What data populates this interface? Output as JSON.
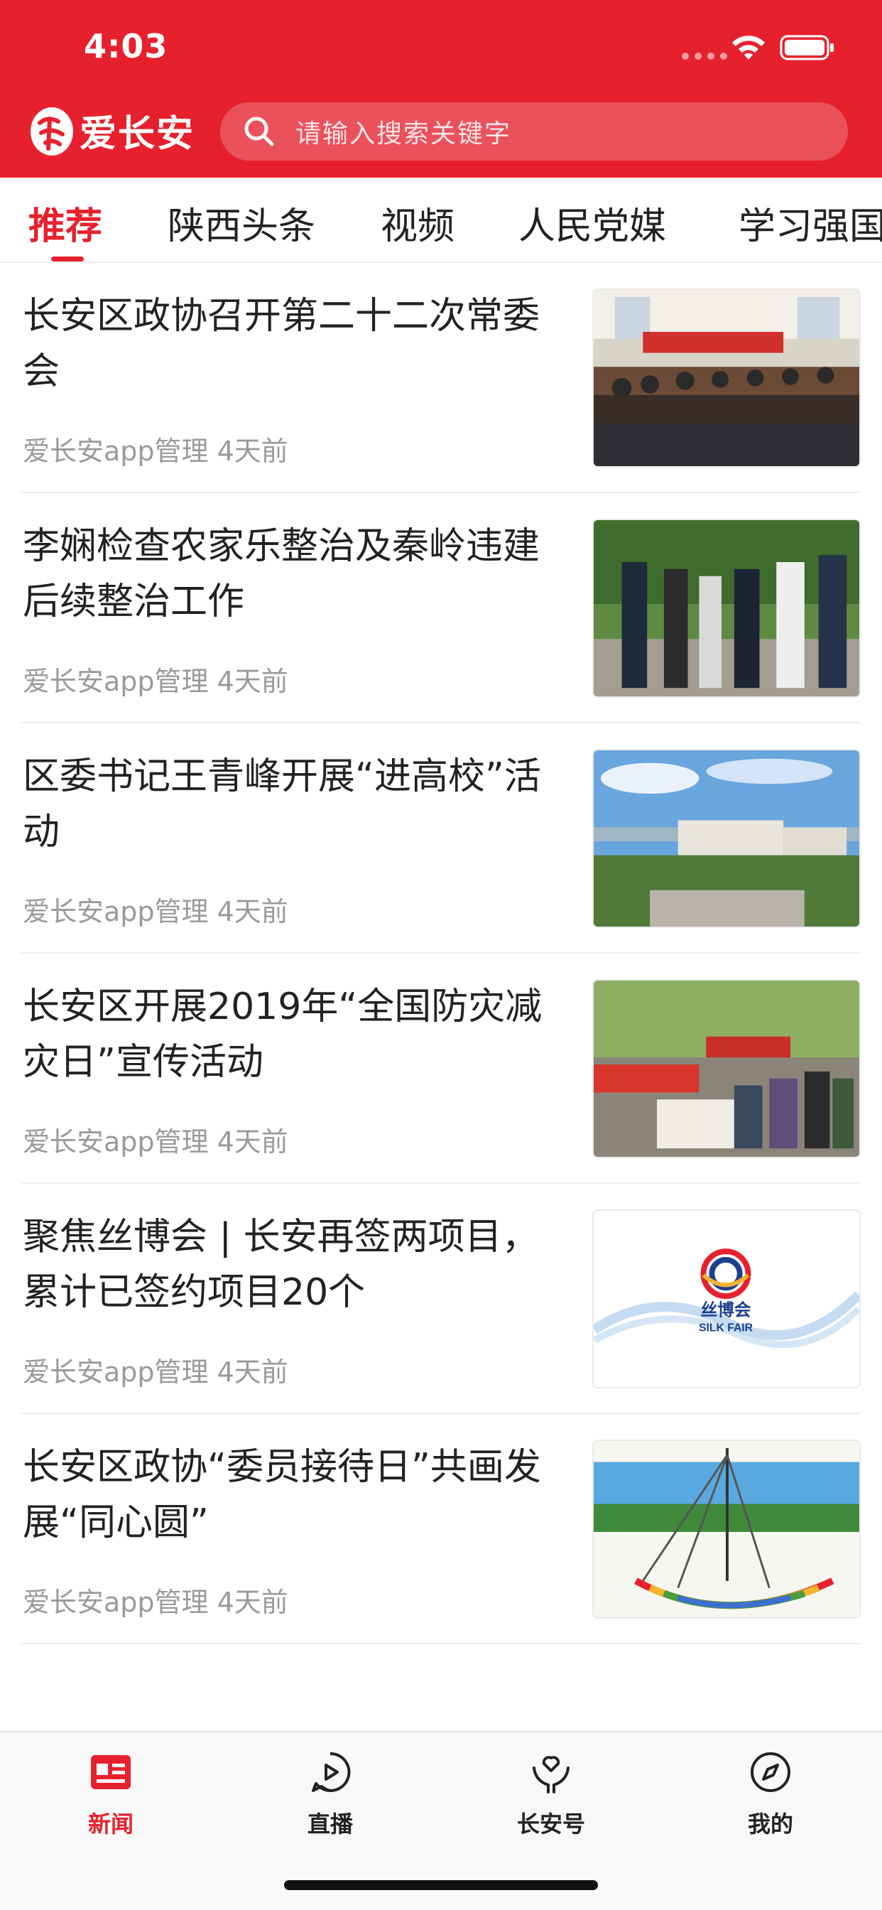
{
  "status_bar": {
    "time": "4:03"
  },
  "header": {
    "logo_text": "爱长安",
    "search_placeholder": "请输入搜索关键字",
    "brand_color": "#e6212d"
  },
  "tabs": [
    {
      "label": "推荐",
      "active": true
    },
    {
      "label": "陕西头条",
      "active": false
    },
    {
      "label": "视频",
      "active": false
    },
    {
      "label": "人民党媒",
      "active": false
    },
    {
      "label": "学习强国",
      "active": false
    }
  ],
  "news": [
    {
      "title": "长安区政协召开第二十二次常委会",
      "meta": "爱长安app管理 4天前",
      "thumb": "meeting-room-photo"
    },
    {
      "title": "李娴检查农家乐整治及秦岭违建后续整治工作",
      "meta": "爱长安app管理 4天前",
      "thumb": "officials-outdoor-photo"
    },
    {
      "title": "区委书记王青峰开展“进高校”活动",
      "meta": "爱长安app管理 4天前",
      "thumb": "campus-aerial-photo"
    },
    {
      "title": "长安区开展2019年“全国防灾减灾日”宣传活动",
      "meta": "爱长安app管理 4天前",
      "thumb": "street-event-photo"
    },
    {
      "title": "聚焦丝博会 | 长安再签两项目，累计已签约项目20个",
      "meta": "爱长安app管理 4天前",
      "thumb": "silk-fair-logo",
      "thumb_text_cn": "丝博会",
      "thumb_text_en": "SILK FAIR"
    },
    {
      "title": "长安区政协“委员接待日”共画发展“同心圆”",
      "meta": "爱长安app管理 4天前",
      "thumb": "concentric-circle-painting"
    }
  ],
  "bottom_nav": [
    {
      "label": "新闻",
      "icon": "news-icon",
      "active": true
    },
    {
      "label": "直播",
      "icon": "play-icon",
      "active": false
    },
    {
      "label": "长安号",
      "icon": "heart-hands-icon",
      "active": false
    },
    {
      "label": "我的",
      "icon": "compass-icon",
      "active": false
    }
  ]
}
